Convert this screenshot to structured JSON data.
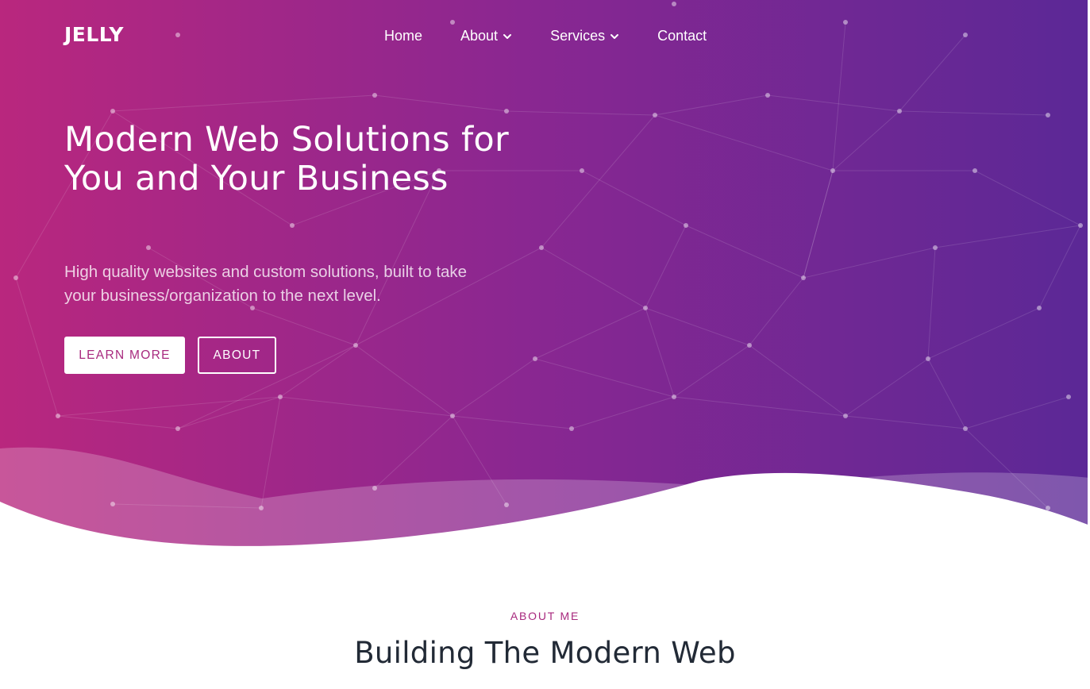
{
  "brand": {
    "logo_text": "JELLY",
    "gradient_start": "#b9277e",
    "gradient_mid": "#8a2791",
    "gradient_end": "#5b2896"
  },
  "nav": {
    "items": [
      {
        "label": "Home",
        "has_dropdown": false
      },
      {
        "label": "About",
        "has_dropdown": true
      },
      {
        "label": "Services",
        "has_dropdown": true
      },
      {
        "label": "Contact",
        "has_dropdown": false
      }
    ]
  },
  "hero": {
    "title": "Modern Web Solutions for You and Your Business",
    "subtitle": "High quality websites and custom solutions, built to take your business/organization to the next level.",
    "primary_button": "LEARN MORE",
    "secondary_button": "ABOUT"
  },
  "about": {
    "eyebrow": "ABOUT ME",
    "heading": "Building The Modern Web"
  },
  "colors": {
    "accent": "#a8297e",
    "heading_dark": "#222a36",
    "white": "#ffffff"
  }
}
